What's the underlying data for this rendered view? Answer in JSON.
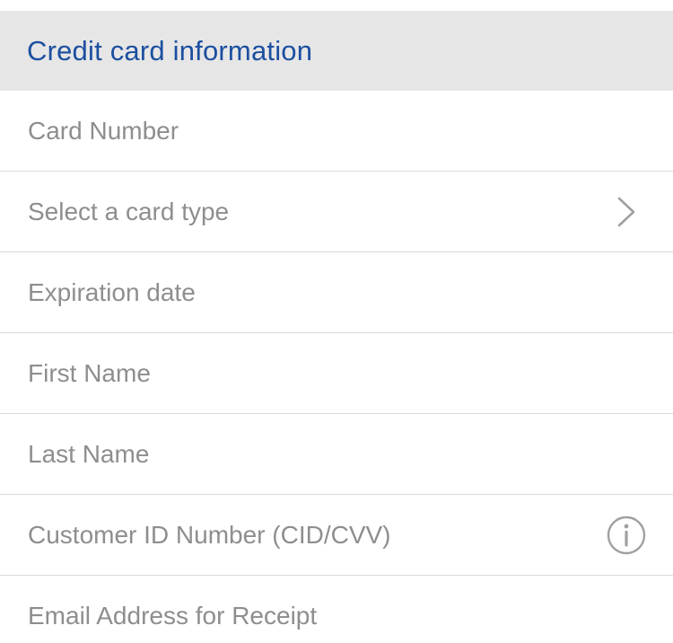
{
  "header": {
    "title": "Credit card information"
  },
  "rows": [
    {
      "placeholder": "Card Number",
      "icon": ""
    },
    {
      "placeholder": "Select a card type",
      "icon": "chevron-right-icon"
    },
    {
      "placeholder": "Expiration date",
      "icon": ""
    },
    {
      "placeholder": "First Name",
      "icon": ""
    },
    {
      "placeholder": "Last Name",
      "icon": ""
    },
    {
      "placeholder": "Customer ID Number (CID/CVV)",
      "icon": "info-icon"
    },
    {
      "placeholder": "Email Address for Receipt",
      "icon": ""
    }
  ],
  "colors": {
    "header_bg": "#e6e6e6",
    "header_text": "#1c4fa0",
    "placeholder_text": "#8e8e8e",
    "divider": "#d9d9d9",
    "icon": "#a0a0a0"
  }
}
